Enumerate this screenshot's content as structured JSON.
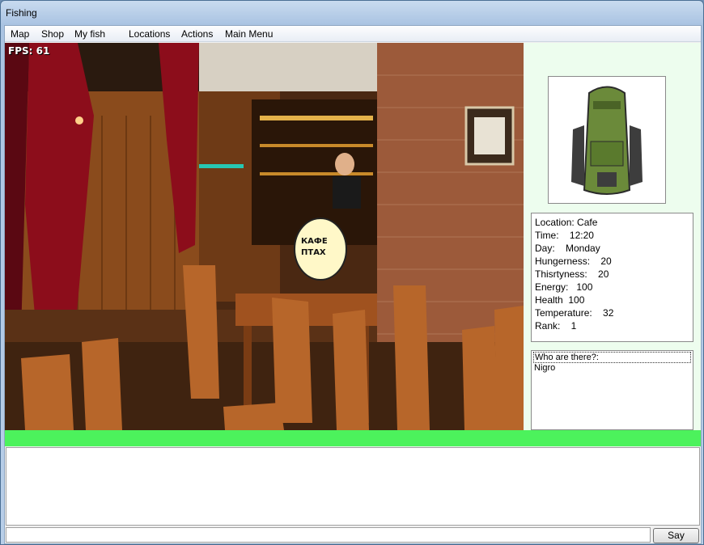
{
  "window": {
    "title": "Fishing"
  },
  "menu": [
    "Map",
    "Shop",
    "My fish",
    "Locations",
    "Actions",
    "Main Menu"
  ],
  "scene": {
    "fps_label": "FPS: 61",
    "sign_text_1": "КАФЕ",
    "sign_text_2": "ПТАХ"
  },
  "stats": {
    "location": "Location: Cafe",
    "time": "Time:    12:20",
    "day": "Day:    Monday",
    "hungerness": "Hungerness:    20",
    "thirstyness": "Thisrtyness:    20",
    "energy": "Energy:   100",
    "health": "Health  100",
    "temperature": "Temperature:    32",
    "rank": "Rank:    1"
  },
  "who": {
    "header": "Who are there?:",
    "items": [
      "Nigro"
    ]
  },
  "chat": {
    "input_value": "",
    "say_label": "Say"
  },
  "colors": {
    "status_bar": "#4cf25c",
    "side_panel": "#edfdee"
  }
}
